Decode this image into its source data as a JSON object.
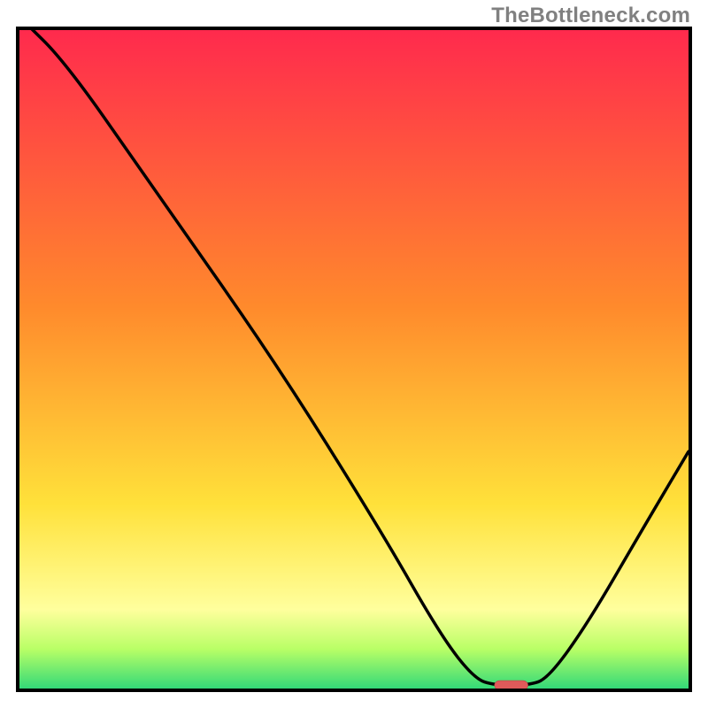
{
  "watermark": "TheBottleneck.com",
  "colors": {
    "border": "#000000",
    "watermark": "#808080",
    "gradient_top": "#ff2a4d",
    "gradient_orange": "#ff8a2c",
    "gradient_yellow": "#ffe13a",
    "gradient_paleyellow": "#ffff9d",
    "gradient_lime": "#b9ff66",
    "gradient_green": "#33d978",
    "curve": "#000000",
    "marker_fill": "#e05a5a",
    "marker_stroke": "#bb4444"
  },
  "chart_data": {
    "type": "line",
    "title": "",
    "xlabel": "",
    "ylabel": "",
    "xlim": [
      0,
      100
    ],
    "ylim": [
      0,
      100
    ],
    "grid": false,
    "curve": [
      {
        "x": 0,
        "y": 102
      },
      {
        "x": 7,
        "y": 95
      },
      {
        "x": 20,
        "y": 76
      },
      {
        "x": 38,
        "y": 50
      },
      {
        "x": 54,
        "y": 24
      },
      {
        "x": 63,
        "y": 8
      },
      {
        "x": 68,
        "y": 1.5
      },
      {
        "x": 71,
        "y": 0.5
      },
      {
        "x": 76,
        "y": 0.5
      },
      {
        "x": 79,
        "y": 1.5
      },
      {
        "x": 85,
        "y": 10
      },
      {
        "x": 93,
        "y": 24
      },
      {
        "x": 100,
        "y": 36
      }
    ],
    "marker": {
      "x": 73.5,
      "y": 0.5,
      "w": 5,
      "h": 1.4
    },
    "annotations": []
  }
}
